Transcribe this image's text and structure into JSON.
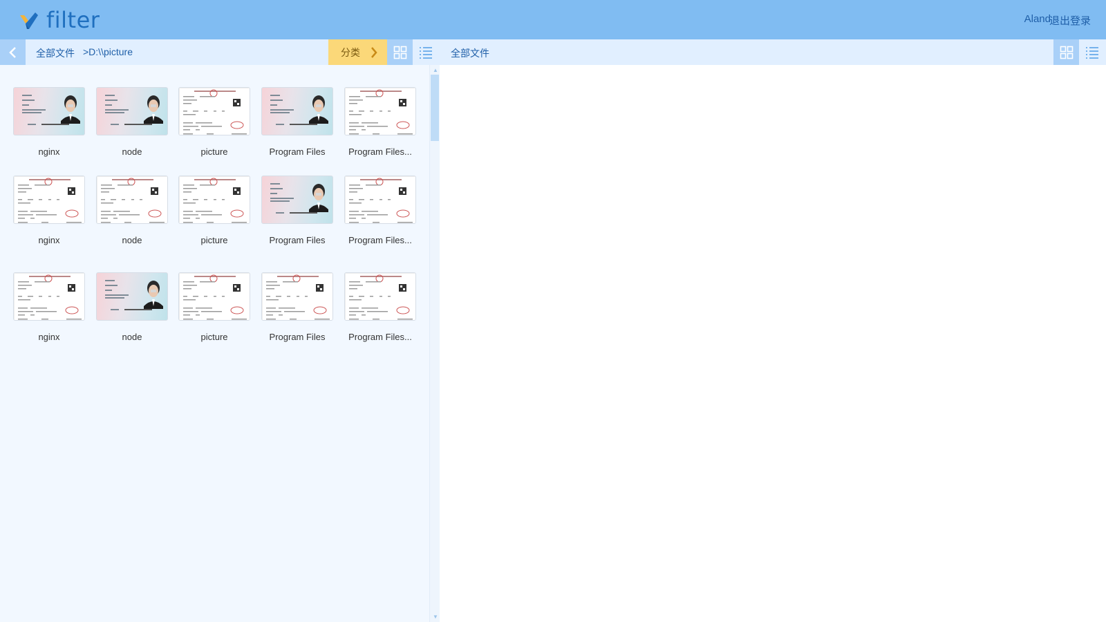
{
  "app": {
    "logo_text": "filter"
  },
  "header": {
    "user": "Aland",
    "logout": "退出登录"
  },
  "left_panel": {
    "breadcrumb_root": "全部文件",
    "breadcrumb_path": ">D:\\\\picture",
    "category_label": "分类"
  },
  "right_panel": {
    "breadcrumb_root": "全部文件"
  },
  "files": [
    {
      "name": "nginx",
      "thumb": "id-card"
    },
    {
      "name": "node",
      "thumb": "id-card"
    },
    {
      "name": "picture",
      "thumb": "certificate"
    },
    {
      "name": "Program Files",
      "thumb": "id-card"
    },
    {
      "name": "Program Files...",
      "thumb": "certificate"
    },
    {
      "name": "nginx",
      "thumb": "certificate"
    },
    {
      "name": "node",
      "thumb": "certificate"
    },
    {
      "name": "picture",
      "thumb": "certificate"
    },
    {
      "name": "Program Files",
      "thumb": "id-card"
    },
    {
      "name": "Program Files...",
      "thumb": "certificate"
    },
    {
      "name": "nginx",
      "thumb": "certificate"
    },
    {
      "name": "node",
      "thumb": "id-card"
    },
    {
      "name": "picture",
      "thumb": "certificate"
    },
    {
      "name": "Program Files",
      "thumb": "certificate"
    },
    {
      "name": "Program Files...",
      "thumb": "certificate"
    }
  ],
  "colors": {
    "header": "#80bcf2",
    "toolbar": "#e1efff",
    "accent_button": "#a9d0f8",
    "category_button": "#fbd879"
  }
}
